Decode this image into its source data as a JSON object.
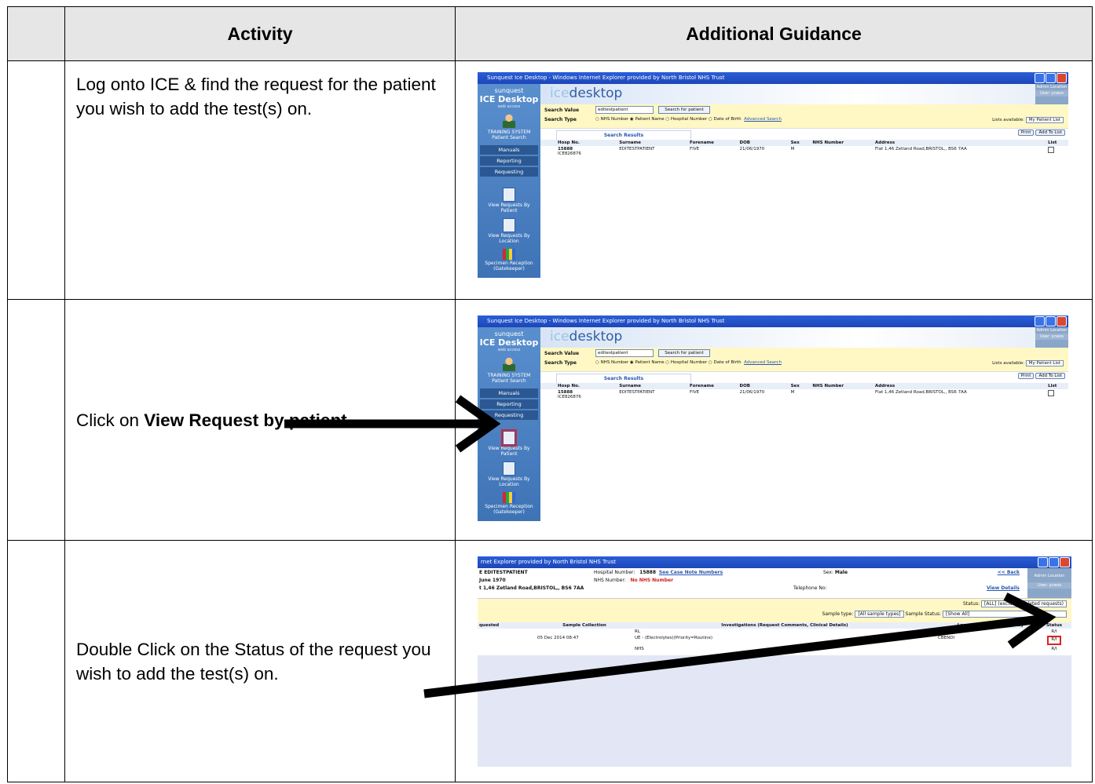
{
  "table": {
    "header": {
      "col0": "",
      "activity": "Activity",
      "guidance": "Additional Guidance"
    },
    "rows": [
      {
        "step": "",
        "activity_text": "Log onto ICE & find the request for the patient you wish to add the test(s) on."
      },
      {
        "step": "",
        "activity_prefix": "Click on ",
        "activity_bold": "View Request by patient"
      },
      {
        "step": "",
        "activity_text": "Double Click on the Status of the request you wish to add the test(s) on."
      }
    ]
  },
  "ice": {
    "window_title": "Sunquest Ice Desktop - Windows Internet Explorer provided by North Bristol NHS Trust",
    "logo_top": "sunquest",
    "logo_main": "ICE Desktop",
    "logo_sub": "web access",
    "app_title_a": "ice",
    "app_title_b": "desktop",
    "system_label": "TRAINING SYSTEM",
    "patient_search": "Patient Search",
    "menu": [
      "Manuals",
      "Reporting",
      "Requesting"
    ],
    "nav": [
      "View Requests By Patient",
      "View Requests By Location",
      "Specimen Reception (Gatekeeper)"
    ],
    "user_box": "Admin Location",
    "user_label": "User: ycwos",
    "search_value_label": "Search Value",
    "search_value": "editestpatient",
    "search_button": "Search for patient",
    "search_type_label": "Search Type",
    "search_types": [
      "NHS Number",
      "Patient Name",
      "Hospital Number",
      "Date of Birth"
    ],
    "advanced_search": "Advanced Search",
    "lists_label": "Lists available:",
    "lists_value": "My Patient List",
    "results_tab": "Search Results",
    "print_btn": "Print",
    "add_list_btn": "Add To List",
    "columns": [
      "Hosp No.",
      "Surname",
      "Forename",
      "DOB",
      "Sex",
      "NHS Number",
      "Address",
      "List"
    ],
    "result_row": {
      "hosp_no": "15888",
      "hosp_no2": "ICE826876",
      "surname": "EDITESTPATIENT",
      "forename": "FIVE",
      "dob": "21/06/1970",
      "sex": "M",
      "nhs": "",
      "address": "Flat 1,46 Zetland Road,BRISTOL,, BS6 7AA"
    }
  },
  "request_view": {
    "window_title": "rnet Explorer provided by North Bristol NHS Trust",
    "patient_name": "E EDITESTPATIENT",
    "dob": "June 1970",
    "address": "t 1,46 Zetland Road,BRISTOL,, BS6 7AA",
    "hospital_number_label": "Hospital Number:",
    "hospital_number": "15888",
    "see_case_notes": "See Case Note Numbers",
    "nhs_number_label": "NHS Number:",
    "nhs_number": "No NHS Number",
    "telephone_label": "Telephone No:",
    "sex_label": "Sex:",
    "sex": "Male",
    "back_link": "<< Back",
    "view_details": "View Details",
    "status_label": "Status:",
    "status_value": "[ALL] (excludes deleted requests)",
    "sample_type_label": "Sample type:",
    "sample_type_value": "[All sample types]",
    "sample_status_label": "Sample Status:",
    "sample_status_value": "[Show All]",
    "columns": [
      "quested",
      "Sample Collection",
      "Investigations (Request Comments, Clinical Details)",
      "Loc",
      "Raised By",
      "Status"
    ],
    "rows": [
      {
        "requested": "",
        "collection": "",
        "investigation": "RL",
        "loc": "CBENDI",
        "status": "R/I"
      },
      {
        "requested": "",
        "collection": "05 Dec 2014 08:47",
        "investigation": "UE - (Electrolytes)(Priority=Routine)",
        "loc": "CBENDI",
        "status": "R/I"
      },
      {
        "requested": "",
        "collection": "",
        "investigation": "NHS",
        "loc": "",
        "status": "R/I"
      }
    ]
  }
}
